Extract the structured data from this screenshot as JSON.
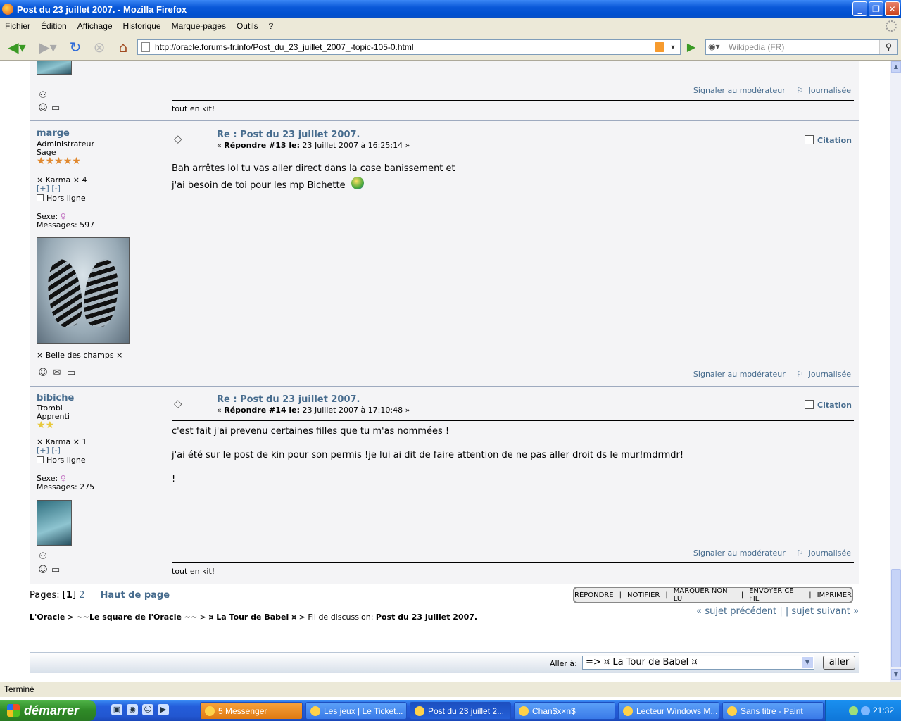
{
  "window": {
    "title": "Post du 23 juillet 2007. - Mozilla Firefox",
    "minimize": "_",
    "maximize": "❐",
    "close": "✕"
  },
  "menu": [
    "Fichier",
    "Édition",
    "Affichage",
    "Historique",
    "Marque-pages",
    "Outils",
    "?"
  ],
  "nav": {
    "url": "http://oracle.forums-fr.info/Post_du_23_juillet_2007_-topic-105-0.html",
    "search_placeholder": "Wikipedia (FR)"
  },
  "icons": {
    "back": "back-arrow-icon",
    "forward": "forward-arrow-icon",
    "reload": "reload-icon",
    "stop": "stop-icon",
    "home": "home-icon"
  },
  "post_top": {
    "report": "Signaler au modérateur",
    "logged": "Journalisée",
    "signature": "tout en kit!"
  },
  "post2": {
    "author": "marge",
    "role": "Administrateur",
    "rank": "Sage",
    "stars": 5,
    "karma": "× Karma × 4",
    "karma_plus": "[+]",
    "karma_minus": "[-]",
    "online": "Hors ligne",
    "sex_label": "Sexe:",
    "messages": "Messages: 597",
    "tagline": "× Belle des champs ×",
    "title": "Re : Post du 23 juillet 2007.",
    "meta_prefix": "« ",
    "meta_bold": "Répondre #13 le:",
    "meta_date": " 23 Juillet 2007 à 16:25:14 »",
    "quote": "Citation",
    "body": [
      "Bah arrêtes lol tu vas aller direct dans la case banissement et",
      "j'ai besoin de toi pour les mp Bichette"
    ],
    "report": "Signaler au modérateur",
    "logged": "Journalisée"
  },
  "post3": {
    "author": "bibiche",
    "role": "Trombi",
    "rank": "Apprenti",
    "stars": 2,
    "karma": "× Karma × 1",
    "karma_plus": "[+]",
    "karma_minus": "[-]",
    "online": "Hors ligne",
    "sex_label": "Sexe:",
    "messages": "Messages: 275",
    "title": "Re : Post du 23 juillet 2007.",
    "meta_prefix": "« ",
    "meta_bold": "Répondre #14 le:",
    "meta_date": " 23 Juillet 2007 à 17:10:48 »",
    "quote": "Citation",
    "body": [
      "c'est fait j'ai prevenu certaines filles que tu m'as nommées !",
      "j'ai été sur le post de kin pour son permis !je lui ai dit de faire attention de ne pas aller droit ds le mur!mdrmdr!",
      "!"
    ],
    "report": "Signaler au modérateur",
    "logged": "Journalisée",
    "signature": "tout en kit!"
  },
  "pages": {
    "label": "Pages: ",
    "current": "1",
    "other": "2",
    "top": "Haut de page"
  },
  "actions": [
    "RÉPONDRE",
    "NOTIFIER",
    "MARQUER NON LU",
    "ENVOYER CE FIL",
    "IMPRIMER"
  ],
  "topicnav": {
    "prev": "« sujet précédent",
    "sep": " | ",
    "next": "| sujet suivant »"
  },
  "breadcrumb": {
    "home": "L'Oracle",
    "cat": "~~Le square de l'Oracle ~~",
    "board": "¤ La Tour de Babel ¤",
    "thread_label": "Fil de discussion: ",
    "thread": "Post du 23 juillet 2007.",
    "gt": " > "
  },
  "jump": {
    "label": "Aller à:",
    "selected": "=> ¤ La Tour de Babel ¤",
    "go": "aller"
  },
  "status": "Terminé",
  "taskbar": {
    "start": "démarrer",
    "tasks": [
      "5 Messenger",
      "Les jeux | Le Ticket...",
      "Post du 23 juillet 2...",
      "Chan$x×n$",
      "Lecteur Windows M...",
      "Sans titre - Paint"
    ],
    "clock": "21:32"
  }
}
